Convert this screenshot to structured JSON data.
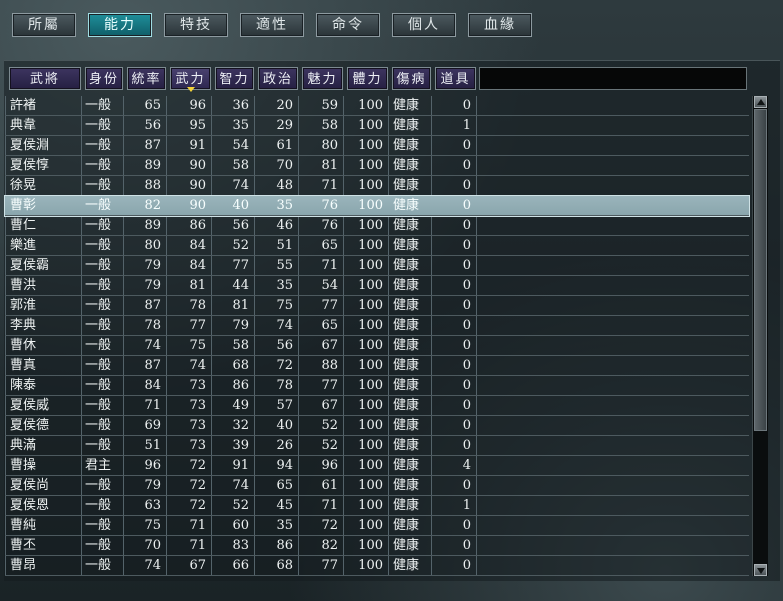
{
  "tabs": [
    "所屬",
    "能力",
    "特技",
    "適性",
    "命令",
    "個人",
    "血緣"
  ],
  "active_tab": 1,
  "columns": [
    "武將",
    "身份",
    "統率",
    "武力",
    "智力",
    "政治",
    "魅力",
    "體力",
    "傷病",
    "道具"
  ],
  "sorted_column": 3,
  "selected_row": 5,
  "rows": [
    [
      "許褚",
      "一般",
      "65",
      "96",
      "36",
      "20",
      "59",
      "100",
      "健康",
      "0"
    ],
    [
      "典韋",
      "一般",
      "56",
      "95",
      "35",
      "29",
      "58",
      "100",
      "健康",
      "1"
    ],
    [
      "夏侯淵",
      "一般",
      "87",
      "91",
      "54",
      "61",
      "80",
      "100",
      "健康",
      "0"
    ],
    [
      "夏侯惇",
      "一般",
      "89",
      "90",
      "58",
      "70",
      "81",
      "100",
      "健康",
      "0"
    ],
    [
      "徐晃",
      "一般",
      "88",
      "90",
      "74",
      "48",
      "71",
      "100",
      "健康",
      "0"
    ],
    [
      "曹彰",
      "一般",
      "82",
      "90",
      "40",
      "35",
      "76",
      "100",
      "健康",
      "0"
    ],
    [
      "曹仁",
      "一般",
      "89",
      "86",
      "56",
      "46",
      "76",
      "100",
      "健康",
      "0"
    ],
    [
      "樂進",
      "一般",
      "80",
      "84",
      "52",
      "51",
      "65",
      "100",
      "健康",
      "0"
    ],
    [
      "夏侯霸",
      "一般",
      "79",
      "84",
      "77",
      "55",
      "71",
      "100",
      "健康",
      "0"
    ],
    [
      "曹洪",
      "一般",
      "79",
      "81",
      "44",
      "35",
      "54",
      "100",
      "健康",
      "0"
    ],
    [
      "郭淮",
      "一般",
      "87",
      "78",
      "81",
      "75",
      "77",
      "100",
      "健康",
      "0"
    ],
    [
      "李典",
      "一般",
      "78",
      "77",
      "79",
      "74",
      "65",
      "100",
      "健康",
      "0"
    ],
    [
      "曹休",
      "一般",
      "74",
      "75",
      "58",
      "56",
      "67",
      "100",
      "健康",
      "0"
    ],
    [
      "曹真",
      "一般",
      "87",
      "74",
      "68",
      "72",
      "88",
      "100",
      "健康",
      "0"
    ],
    [
      "陳泰",
      "一般",
      "84",
      "73",
      "86",
      "78",
      "77",
      "100",
      "健康",
      "0"
    ],
    [
      "夏侯威",
      "一般",
      "71",
      "73",
      "49",
      "57",
      "67",
      "100",
      "健康",
      "0"
    ],
    [
      "夏侯德",
      "一般",
      "69",
      "73",
      "32",
      "40",
      "52",
      "100",
      "健康",
      "0"
    ],
    [
      "典滿",
      "一般",
      "51",
      "73",
      "39",
      "26",
      "52",
      "100",
      "健康",
      "0"
    ],
    [
      "曹操",
      "君主",
      "96",
      "72",
      "91",
      "94",
      "96",
      "100",
      "健康",
      "4"
    ],
    [
      "夏侯尚",
      "一般",
      "79",
      "72",
      "74",
      "65",
      "61",
      "100",
      "健康",
      "0"
    ],
    [
      "夏侯恩",
      "一般",
      "63",
      "72",
      "52",
      "45",
      "71",
      "100",
      "健康",
      "1"
    ],
    [
      "曹純",
      "一般",
      "75",
      "71",
      "60",
      "35",
      "72",
      "100",
      "健康",
      "0"
    ],
    [
      "曹丕",
      "一般",
      "70",
      "71",
      "83",
      "86",
      "82",
      "100",
      "健康",
      "0"
    ],
    [
      "曹昂",
      "一般",
      "74",
      "67",
      "66",
      "68",
      "77",
      "100",
      "健康",
      "0"
    ]
  ],
  "colors": {
    "selected_row": "#8aa6ad",
    "header_bg": "#2d2750",
    "active_tab": "#0f5e69",
    "sort_marker": "#f2d23a"
  }
}
